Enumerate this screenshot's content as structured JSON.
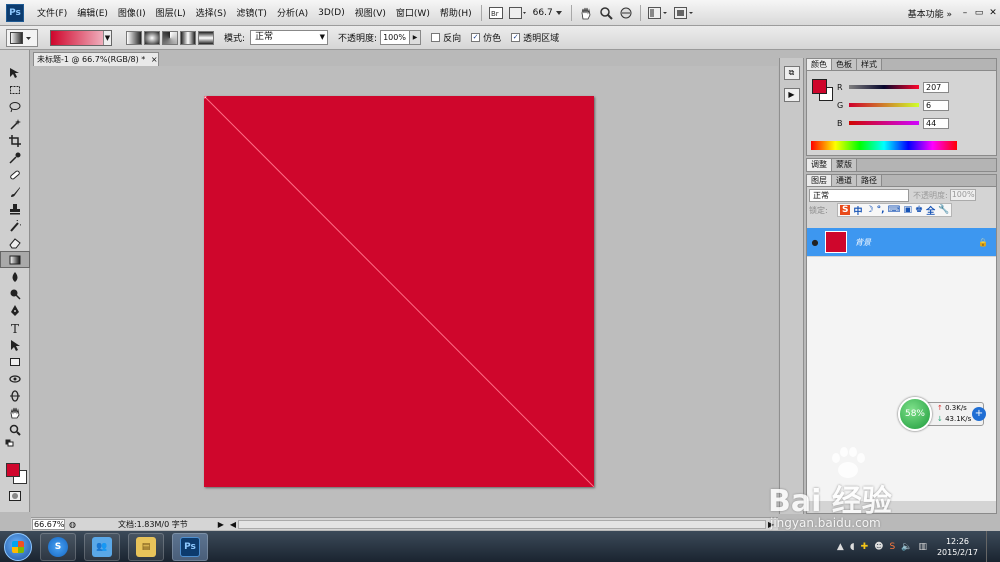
{
  "menubar": {
    "logo": "Ps",
    "items": [
      "文件(F)",
      "编辑(E)",
      "图像(I)",
      "图层(L)",
      "选择(S)",
      "滤镜(T)",
      "分析(A)",
      "3D(D)",
      "视图(V)",
      "窗口(W)",
      "帮助(H)"
    ],
    "zoom_value": "66.7",
    "workspace": "基本功能",
    "window_controls": [
      "–",
      "▭",
      "✕"
    ]
  },
  "options": {
    "mode_label": "模式:",
    "mode_value": "正常",
    "opacity_label": "不透明度:",
    "opacity_value": "100%",
    "reverse_label": "反向",
    "dither_label": "仿色",
    "transparency_label": "透明区域",
    "reverse_checked": false,
    "dither_checked": true,
    "transparency_checked": true
  },
  "document": {
    "tab_label": "未标题-1 @ 66.7%(RGB/8) *",
    "close": "×",
    "canvas_color": "#cf062c",
    "zoom": "66.67%",
    "doc_info": "文档:1.83M/0 字节"
  },
  "color_panel": {
    "tabs": [
      "颜色",
      "色板",
      "样式"
    ],
    "foreground": "#cf062c",
    "background": "#ffffff",
    "channels": [
      {
        "label": "R",
        "value": "207"
      },
      {
        "label": "G",
        "value": "6"
      },
      {
        "label": "B",
        "value": "44"
      }
    ]
  },
  "adjust_panel": {
    "tabs": [
      "调整",
      "蒙版"
    ]
  },
  "layers_panel": {
    "tabs": [
      "图层",
      "通道",
      "路径"
    ],
    "blend_mode": "正常",
    "opacity_label": "不透明度:",
    "opacity_value": "100%",
    "lock_label": "锁定:",
    "ime_items": [
      "S",
      "中",
      "☽",
      "°,",
      "⌨",
      "▣",
      "♚",
      "全",
      "🔧"
    ],
    "layer_name": "背景"
  },
  "network_widget": {
    "percent": "58%",
    "up": "0.3K/s",
    "down": "43.1K/s",
    "plus": "+"
  },
  "taskbar": {
    "ps_label": "Ps",
    "clock_time": "12:26",
    "clock_date": "2015/2/17"
  },
  "watermark": {
    "brand": "Bai 经验",
    "url": "jingyan.baidu.com"
  },
  "icons": [
    "move-icon",
    "marquee-icon",
    "lasso-icon",
    "magic-wand-icon",
    "crop-icon",
    "eyedropper-icon",
    "healing-brush-icon",
    "brush-icon",
    "stamp-icon",
    "history-brush-icon",
    "eraser-icon",
    "gradient-icon",
    "blur-icon",
    "dodge-icon",
    "pen-icon",
    "type-icon",
    "path-select-icon",
    "shape-icon",
    "3d-rotate-icon",
    "3d-orbit-icon",
    "hand-icon",
    "zoom-icon"
  ]
}
